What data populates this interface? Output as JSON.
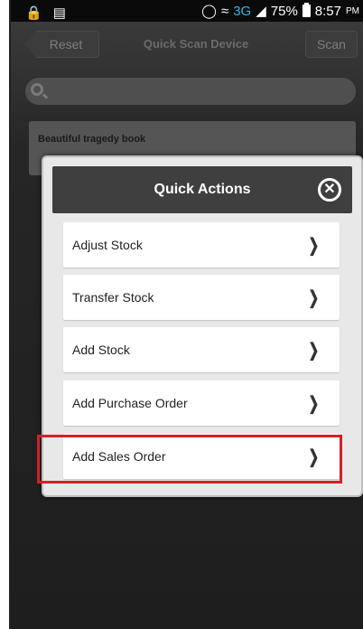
{
  "status_bar": {
    "network": "3G",
    "battery": "75%",
    "time": "8:57",
    "ampm": "PM"
  },
  "background_app": {
    "reset_label": "Reset",
    "title": "Quick Scan Device",
    "scan_label": "Scan",
    "item_title": "Beautiful tragedy book"
  },
  "modal": {
    "title": "Quick Actions",
    "actions": [
      {
        "label": "Adjust Stock"
      },
      {
        "label": "Transfer Stock"
      },
      {
        "label": "Add Stock"
      },
      {
        "label": "Add Purchase Order"
      },
      {
        "label": "Add Sales Order"
      }
    ]
  },
  "icons": {
    "close": "close-icon",
    "chevron": "chevron-right-icon",
    "search": "search-icon"
  },
  "colors": {
    "highlight": "#d62027",
    "modal_header": "#3f3f3f",
    "network_accent": "#33b5e5"
  }
}
